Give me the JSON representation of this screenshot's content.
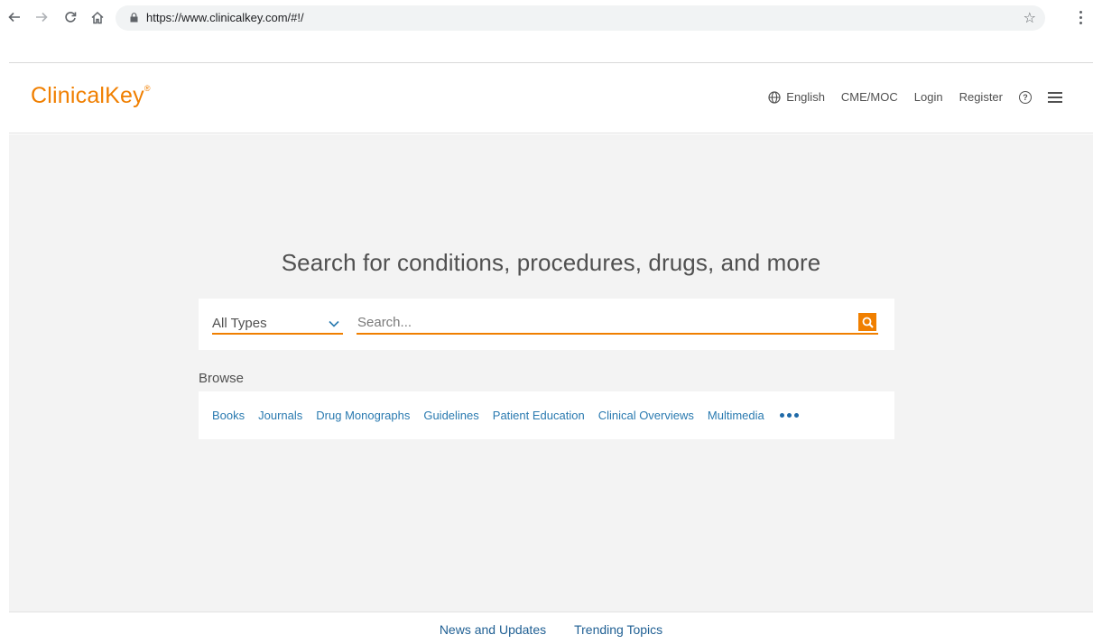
{
  "browser": {
    "url": "https://www.clinicalkey.com/#!/",
    "icons": [
      "back-arrow-icon",
      "forward-arrow-icon",
      "reload-icon",
      "home-icon",
      "lock-icon",
      "star-icon",
      "kebab-menu-icon"
    ]
  },
  "header": {
    "logo": "ClinicalKey",
    "logo_mark": "®",
    "nav": {
      "language": "English",
      "cme": "CME/MOC",
      "login": "Login",
      "register": "Register",
      "help": "?"
    }
  },
  "main": {
    "headline": "Search for conditions, procedures, drugs, and more",
    "search": {
      "type_selected": "All Types",
      "placeholder": "Search..."
    },
    "browse": {
      "label": "Browse",
      "links": [
        "Books",
        "Journals",
        "Drug Monographs",
        "Guidelines",
        "Patient Education",
        "Clinical Overviews",
        "Multimedia"
      ]
    }
  },
  "footer": {
    "links": [
      "News and Updates",
      "Trending Topics"
    ]
  },
  "colors": {
    "brand_orange": "#f07f00",
    "link_blue": "#2a7ab0",
    "background_gray": "#f3f3f3"
  }
}
